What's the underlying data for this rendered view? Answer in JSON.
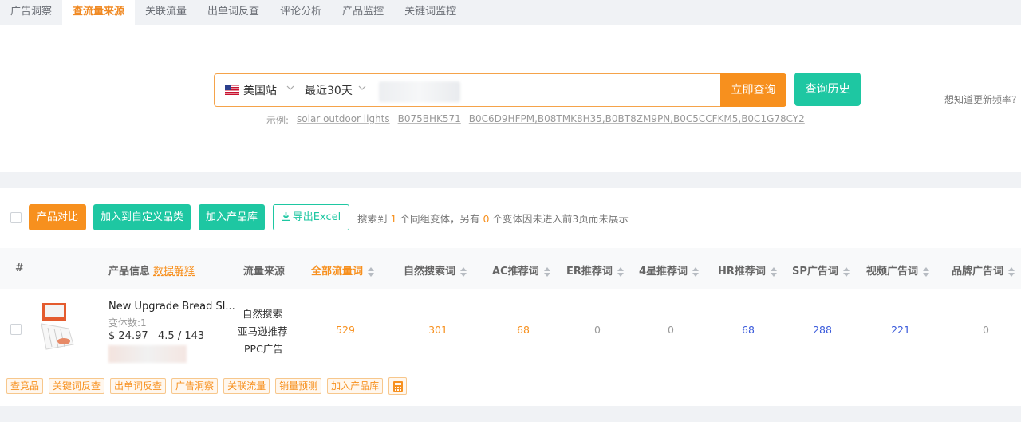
{
  "tabs": [
    {
      "label": "广告洞察"
    },
    {
      "label": "查流量来源"
    },
    {
      "label": "关联流量"
    },
    {
      "label": "出单词反查"
    },
    {
      "label": "评论分析"
    },
    {
      "label": "产品监控"
    },
    {
      "label": "关键词监控"
    }
  ],
  "active_tab": "查流量来源",
  "search": {
    "site": "美国站",
    "period": "最近30天",
    "query_button": "立即查询",
    "history_button": "查询历史",
    "examples_label": "示例:",
    "examples": [
      "solar outdoor lights",
      "B075BHK571",
      "B0C6D9HFPM,B08TMK8H35,B0BT8ZM9PN,B0C5CCFKM5,B0C1G78CY2"
    ],
    "update_freq": "想知道更新频率?"
  },
  "actions": {
    "compare": "产品对比",
    "add_category": "加入到自定义品类",
    "add_library": "加入产品库",
    "export": "导出Excel",
    "summary": {
      "prefix": "搜索到",
      "count": "1",
      "mid": "个同组变体，另有",
      "hidden": "0",
      "suffix": "个变体因未进入前3页而未展示"
    }
  },
  "table": {
    "headers": {
      "index": "#",
      "product": "产品信息",
      "product_link": "数据解释",
      "source": "流量来源",
      "all": "全部流量词",
      "organic": "自然搜索词",
      "ac": "AC推荐词",
      "er": "ER推荐词",
      "four_star": "4星推荐词",
      "hr": "HR推荐词",
      "sp": "SP广告词",
      "video": "视频广告词",
      "brand": "品牌广告词"
    },
    "rows": [
      {
        "name": "New Upgrade Bread Sl...",
        "variants": "变体数:1",
        "price": "$ 24.97",
        "rating": "4.5",
        "reviews": "143",
        "sources": [
          "自然搜索",
          "亚马逊推荐",
          "PPC广告"
        ],
        "all": "529",
        "organic": "301",
        "ac": "68",
        "er": "0",
        "four_star": "0",
        "hr": "68",
        "sp": "288",
        "video": "221",
        "brand": "0"
      }
    ]
  },
  "tags": [
    "查竞品",
    "关键词反查",
    "出单词反查",
    "广告洞察",
    "关联流量",
    "销量预测",
    "加入产品库"
  ],
  "colors": {
    "accent": "#f7901e",
    "teal": "#1ec7a2",
    "blue": "#3b5bdb"
  }
}
